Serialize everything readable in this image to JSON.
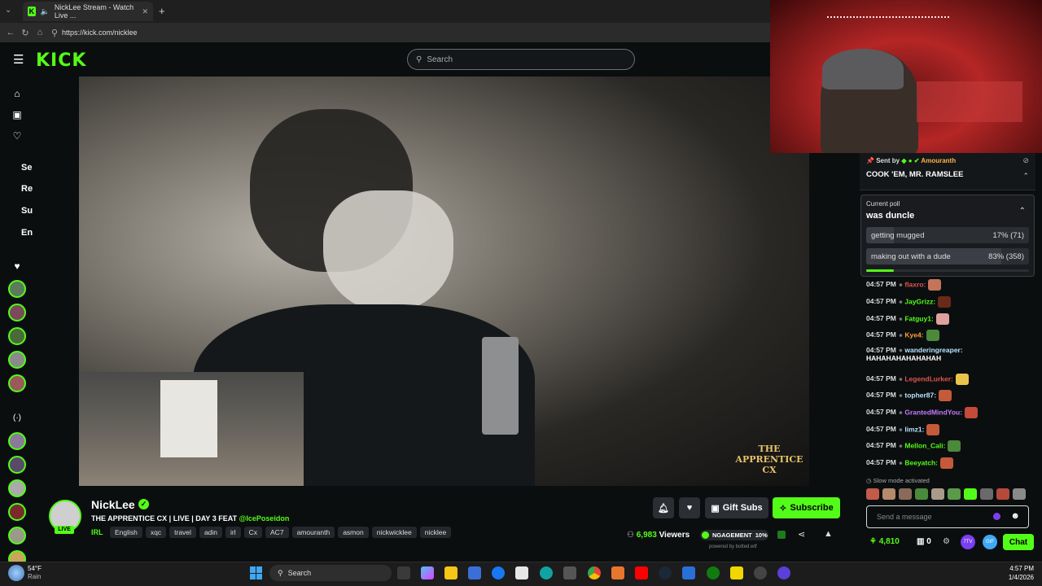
{
  "browser": {
    "tab_title": "NickLee Stream - Watch Live ...",
    "tab_close": "✕",
    "new_tab": "+",
    "url": "https://kick.com/nicklee"
  },
  "header": {
    "logo": "KICK",
    "search_placeholder": "Search"
  },
  "sidebar": {
    "labels": [
      "Se",
      "Re",
      "Su",
      "En"
    ]
  },
  "video": {
    "overlay_text": "THE APPRENTICE CX"
  },
  "streamer": {
    "name": "NickLee",
    "live_badge": "LIVE",
    "title_prefix": "THE APPRENTICE CX | LIVE | DAY 3 FEAT ",
    "title_mention": "@IcePoseidon",
    "category": "IRL",
    "tags": [
      "English",
      "xqc",
      "travel",
      "adin",
      "irl",
      "Cx",
      "AC7",
      "amouranth",
      "asmon",
      "nickwicklee",
      "nicklee"
    ],
    "viewers_count": "6,983",
    "viewers_label": "Viewers",
    "engagement_label": "NGAGEMENT",
    "engagement_value": "10%",
    "powered_by": "powered by botted.wtf",
    "gift_subs_label": "Gift Subs",
    "subscribe_label": "Subscribe"
  },
  "chat": {
    "pinned": {
      "sent_by": "Sent by",
      "sender": "Amouranth",
      "message": "COOK 'EM, MR. RAMSLEE"
    },
    "poll": {
      "label": "Current poll",
      "question": "was duncle",
      "options": [
        {
          "text": "getting mugged",
          "result": "17% (71)",
          "fraction": 0.17
        },
        {
          "text": "making out with a dude",
          "result": "83% (358)",
          "fraction": 0.83
        }
      ]
    },
    "messages": [
      {
        "time": "04:57 PM",
        "user": "flaxro:",
        "color": "#e0544f",
        "text": ""
      },
      {
        "time": "04:57 PM",
        "user": "JayGrizz:",
        "color": "#53fc18",
        "text": ""
      },
      {
        "time": "04:57 PM",
        "user": "Fatguy1:",
        "color": "#53fc18",
        "text": ""
      },
      {
        "time": "04:57 PM",
        "user": "Kye4:",
        "color": "#ff9d3b",
        "text": ""
      },
      {
        "time": "04:57 PM",
        "user": "wanderingreaper:",
        "color": "#b7e3ff",
        "text": "HAHAHAHAHAHAHAH"
      },
      {
        "time": "04:57 PM",
        "user": "LegendLurker:",
        "color": "#e0544f",
        "text": ""
      },
      {
        "time": "04:57 PM",
        "user": "topher87:",
        "color": "#b7e3ff",
        "text": ""
      },
      {
        "time": "04:57 PM",
        "user": "GrantedMindYou:",
        "color": "#c47bff",
        "text": ""
      },
      {
        "time": "04:57 PM",
        "user": "limz1:",
        "color": "#b7e3ff",
        "text": ""
      },
      {
        "time": "04:57 PM",
        "user": "Mellon_Cali:",
        "color": "#53fc18",
        "text": ""
      },
      {
        "time": "04:57 PM",
        "user": "Beeyatch:",
        "color": "#53fc18",
        "text": ""
      }
    ],
    "slow_mode": "Slow mode activated",
    "input_placeholder": "Send a message",
    "points": "4,810",
    "count": "0",
    "chat_button": "Chat"
  },
  "taskbar": {
    "weather_temp": "54°F",
    "weather_desc": "Rain",
    "search_label": "Search",
    "time": "4:57 PM",
    "date": "1/4/2026"
  },
  "colors": {
    "accent": "#53fc18",
    "background": "#0b0e0f"
  }
}
